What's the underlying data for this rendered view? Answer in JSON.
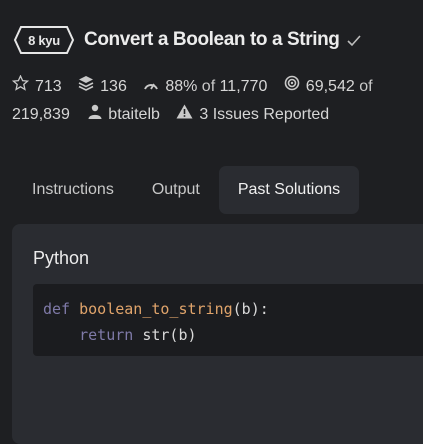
{
  "kata": {
    "rank": "8 kyu",
    "title": "Convert a Boolean to a String"
  },
  "stats": {
    "stars": "713",
    "collections": "136",
    "satisfaction": "88%",
    "satisfaction_of_label": "of",
    "votes": "11,770",
    "completed": "69,542",
    "completed_of_label": "of",
    "attempted": "219,839",
    "author": "btaitelb",
    "issues": "3 Issues Reported"
  },
  "tabs": [
    "Instructions",
    "Output",
    "Past Solutions"
  ],
  "active_tab": "Past Solutions",
  "solution": {
    "language": "Python",
    "code_line1_kw": "def",
    "code_line1_fn": "boolean_to_string",
    "code_line1_rest": "(b):",
    "code_line2_indent": "    ",
    "code_line2_kw": "return",
    "code_line2_rest": " str(b)"
  },
  "icons": {
    "star": "star-icon",
    "collections": "stack-icon",
    "satisfaction": "gauge-icon",
    "completed": "target-icon",
    "author": "user-icon",
    "issues": "warning-icon"
  },
  "colors": {
    "background": "#1e1f22",
    "panel": "#2a2c31",
    "code_background": "#1b1c1f",
    "keyword": "#7f7aa8",
    "function_name": "#e0a46b"
  }
}
